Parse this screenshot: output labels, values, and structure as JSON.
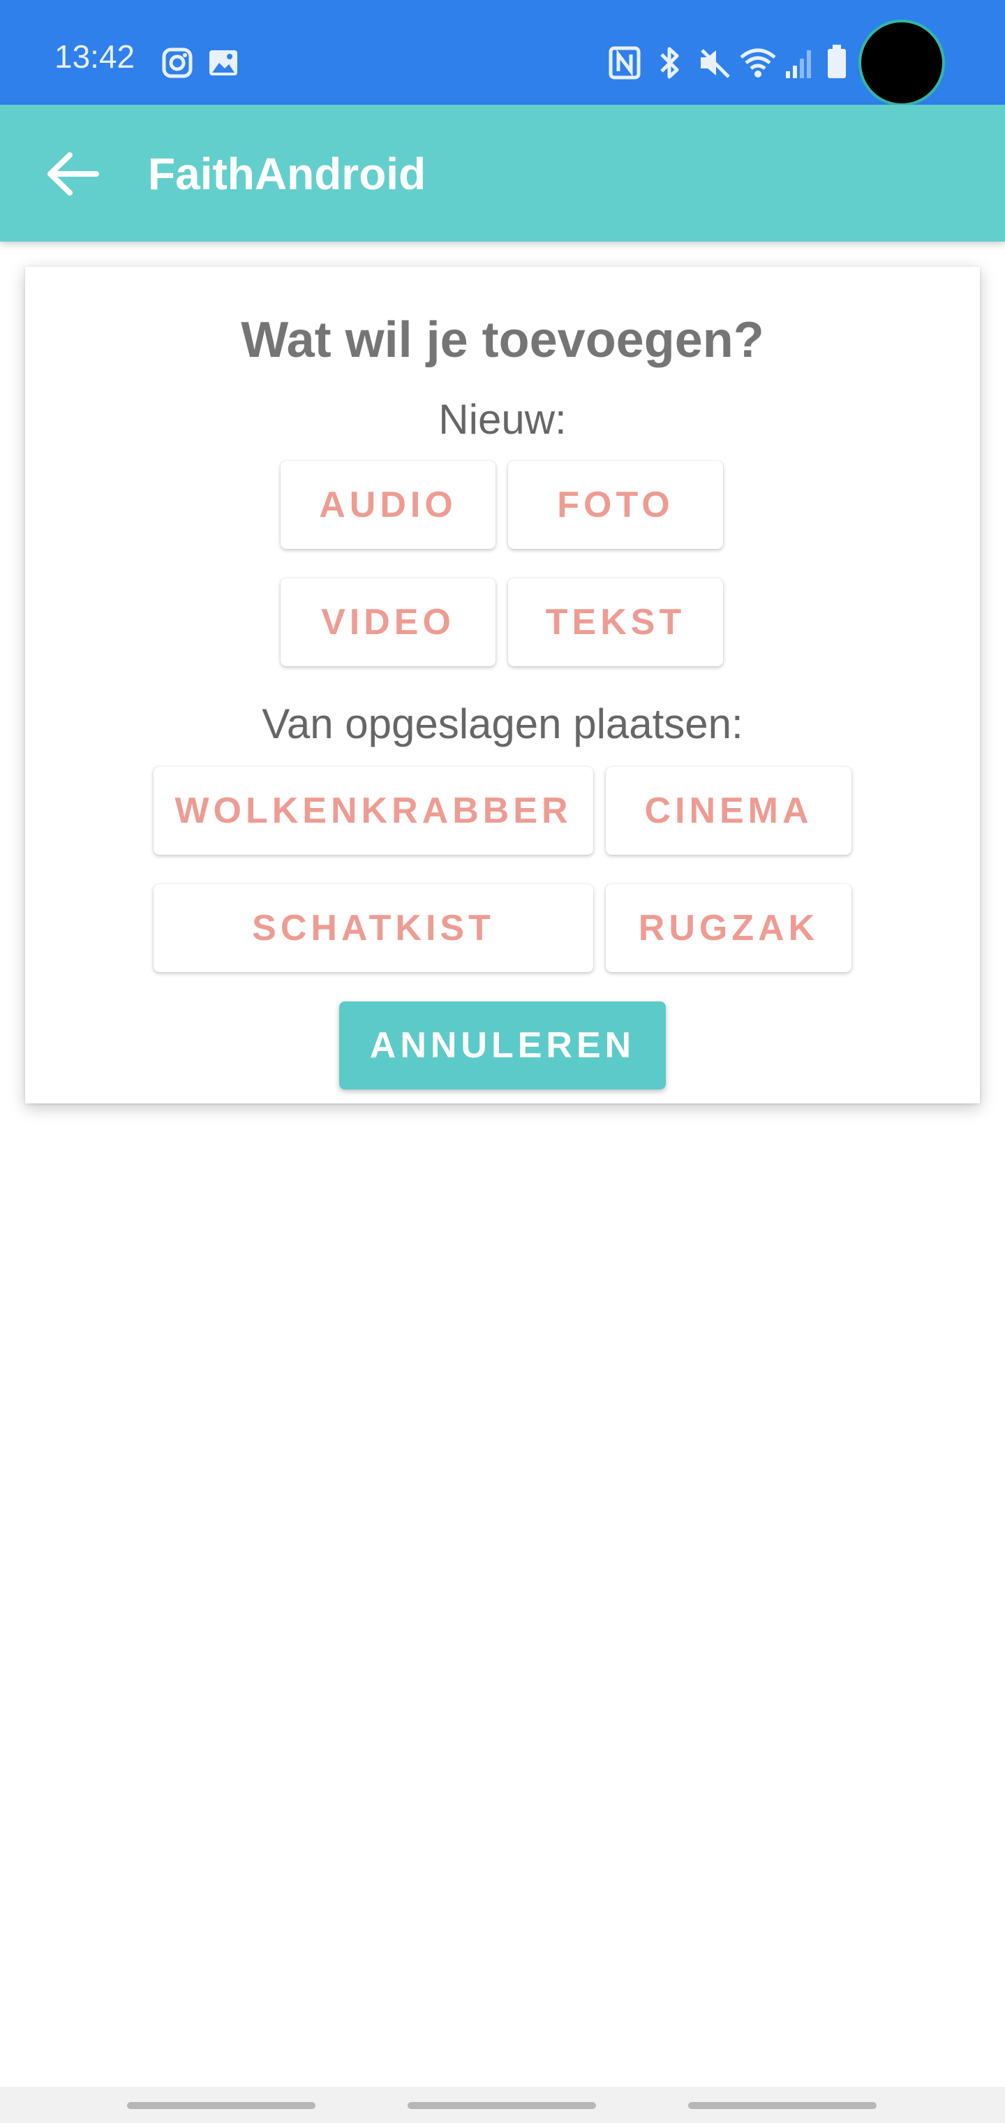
{
  "status_bar": {
    "time": "13:42",
    "left_icons": [
      "instagram-icon",
      "gallery-icon"
    ],
    "right_icons": [
      "nfc-icon",
      "bluetooth-icon",
      "mute-icon",
      "wifi-icon",
      "signal-icon",
      "battery-icon"
    ],
    "color": "#2f80ea"
  },
  "app_bar": {
    "title": "FaithAndroid",
    "color": "#63cfcc"
  },
  "dialog": {
    "title": "Wat wil je toevoegen?",
    "new_label": "Nieuw:",
    "new_buttons": [
      "AUDIO",
      "FOTO",
      "VIDEO",
      "TEKST"
    ],
    "saved_label": "Van opgeslagen plaatsen:",
    "saved_buttons": [
      "WOLKENKRABBER",
      "CINEMA",
      "SCHATKIST",
      "RUGZAK"
    ],
    "cancel_label": "ANNULEREN",
    "button_text_color": "#ee9c93",
    "cancel_color": "#5ccac8"
  }
}
